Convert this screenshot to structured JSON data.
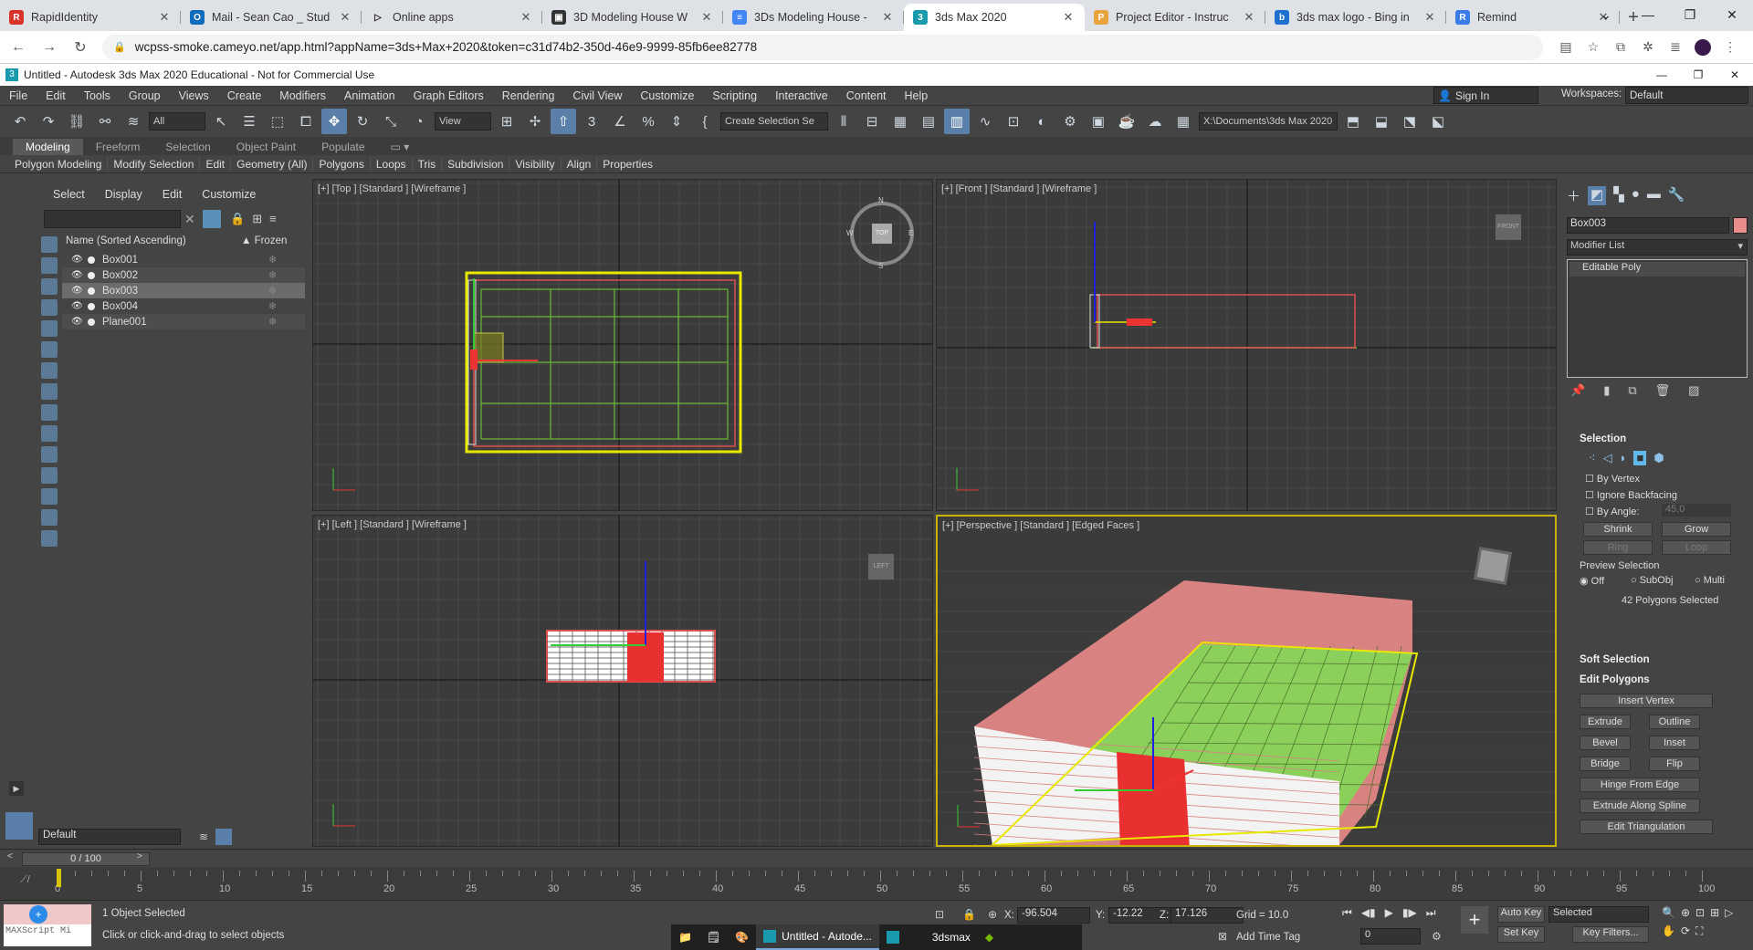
{
  "browser": {
    "tabs": [
      {
        "label": "RapidIdentity",
        "color": "#d9342b"
      },
      {
        "label": "Mail - Sean Cao _ Stud",
        "color": "#0f6cbd"
      },
      {
        "label": "Online apps",
        "color": "#222222"
      },
      {
        "label": "3D Modeling House W",
        "color": "#333333"
      },
      {
        "label": "3Ds Modeling House -",
        "color": "#4285f4"
      },
      {
        "label": "3ds Max 2020",
        "color": "#1a9bad"
      },
      {
        "label": "Project Editor - Instruc",
        "color": "#e8a33d"
      },
      {
        "label": "3ds max logo - Bing in",
        "color": "#1f6fd1"
      },
      {
        "label": "Remind",
        "color": "#3b7de8"
      }
    ],
    "url": "wcpss-smoke.cameyo.net/app.html?appName=3ds+Max+2020&token=c31d74b2-350d-46e9-9999-85fb6ee82778"
  },
  "app": {
    "title": "Untitled - Autodesk 3ds Max 2020 Educational - Not for Commercial Use",
    "menu": [
      "File",
      "Edit",
      "Tools",
      "Group",
      "Views",
      "Create",
      "Modifiers",
      "Animation",
      "Graph Editors",
      "Rendering",
      "Civil View",
      "Customize",
      "Scripting",
      "Interactive",
      "Content",
      "Help"
    ],
    "sign_in": "Sign In",
    "workspaces_label": "Workspaces:",
    "workspace": "Default",
    "filter_all": "All",
    "view_drop": "View",
    "selection_set": "Create Selection Se",
    "project_path": "X:\\Documents\\3ds Max 2020",
    "ribbon_tabs": [
      "Modeling",
      "Freeform",
      "Selection",
      "Object Paint",
      "Populate"
    ],
    "ribbon_items": [
      "Polygon Modeling",
      "Modify Selection",
      "Edit",
      "Geometry (All)",
      "Polygons",
      "Loops",
      "Tris",
      "Subdivision",
      "Visibility",
      "Align",
      "Properties"
    ]
  },
  "scene_explorer": {
    "menu": [
      "Select",
      "Display",
      "Edit",
      "Customize"
    ],
    "col_name": "Name (Sorted Ascending)",
    "col_frozen": "▲ Frozen",
    "rows": [
      "Box001",
      "Box002",
      "Box003",
      "Box004",
      "Plane001"
    ],
    "layer": "Default"
  },
  "viewports": {
    "top": "[+] [Top ] [Standard ] [Wireframe ]",
    "front": "[+] [Front ] [Standard ] [Wireframe ]",
    "left": "[+] [Left ] [Standard ] [Wireframe ]",
    "persp": "[+] [Perspective ] [Standard ] [Edged Faces ]",
    "cube_top": "TOP",
    "cube_front": "FRONT",
    "cube_left": "LEFT",
    "compass": [
      "N",
      "E",
      "S",
      "W"
    ]
  },
  "command_panel": {
    "object_name": "Box003",
    "modifier_list": "Modifier List",
    "stack_item": "Editable Poly",
    "selection_title": "Selection",
    "by_vertex": "By Vertex",
    "ignore_backfacing": "Ignore Backfacing",
    "by_angle": "By Angle:",
    "angle_value": "45.0",
    "shrink": "Shrink",
    "grow": "Grow",
    "ring": "Ring",
    "loop": "Loop",
    "preview_selection": "Preview Selection",
    "preview_off": "Off",
    "preview_subobj": "SubObj",
    "preview_multi": "Multi",
    "selected_count": "42 Polygons Selected",
    "soft_selection": "Soft Selection",
    "edit_polygons": "Edit Polygons",
    "insert_vertex": "Insert Vertex",
    "extrude": "Extrude",
    "outline": "Outline",
    "bevel": "Bevel",
    "inset": "Inset",
    "bridge": "Bridge",
    "flip": "Flip",
    "hinge_from_edge": "Hinge From Edge",
    "extrude_along_spline": "Extrude Along Spline",
    "edit_triangulation": "Edit Triangulation"
  },
  "timeline": {
    "frame": "0 / 100",
    "ticks": [
      "0",
      "5",
      "10",
      "15",
      "20",
      "25",
      "30",
      "35",
      "40",
      "45",
      "50",
      "55",
      "60",
      "65",
      "70",
      "75",
      "80",
      "85",
      "90",
      "95",
      "100"
    ]
  },
  "status": {
    "maxscript": "MAXScript Mi",
    "selected": "1 Object Selected",
    "prompt": "Click or click-and-drag to select objects",
    "x_label": "X:",
    "x": "-96.504",
    "y_label": "Y:",
    "y": "-12.22",
    "z_label": "Z:",
    "z": "17.126",
    "grid": "Grid = 10.0",
    "add_time_tag": "Add Time Tag",
    "auto_key": "Auto Key",
    "set_key": "Set Key",
    "key_mode": "Selected",
    "key_filters": "Key Filters...",
    "frame_field": "0"
  },
  "taskbar": {
    "untitled": "Untitled - Autode...",
    "app": "3dsmax"
  }
}
